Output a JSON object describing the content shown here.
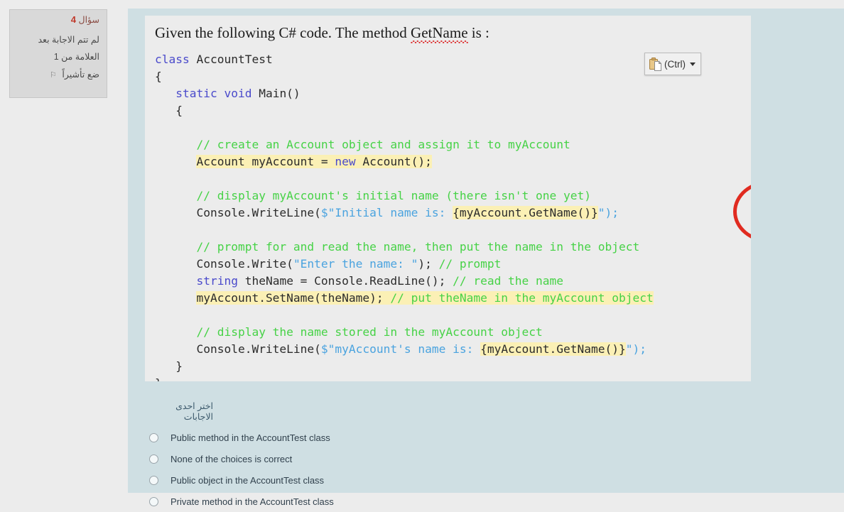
{
  "sidebar": {
    "question_word": "سؤال",
    "question_number": "4",
    "status": "لم تتم الاجابة بعد",
    "mark": "العلامة من 1",
    "flag_label": "ضع تأشيراً",
    "flag_icon": "flag-icon",
    "accent_red": "#c0392b"
  },
  "question": {
    "prompt_before": "Given the following C# code. The method ",
    "prompt_term": "GetName",
    "prompt_after": " is :"
  },
  "paste_options": {
    "label": "(Ctrl)",
    "clipboard_icon": "clipboard-icon",
    "caret_icon": "chevron-down-icon"
  },
  "code": {
    "lines": [
      [
        {
          "t": "class ",
          "c": "kw"
        },
        {
          "t": "AccountTest",
          "c": ""
        }
      ],
      [
        {
          "t": "{",
          "c": ""
        }
      ],
      [
        {
          "t": "   ",
          "c": ""
        },
        {
          "t": "static void ",
          "c": "kw"
        },
        {
          "t": "Main()",
          "c": ""
        }
      ],
      [
        {
          "t": "   {",
          "c": ""
        }
      ],
      [],
      [
        {
          "t": "      ",
          "c": ""
        },
        {
          "t": "// create an Account object and assign it to myAccount",
          "c": "cmt"
        }
      ],
      [
        {
          "t": "      ",
          "c": ""
        },
        {
          "t": "Account myAccount = ",
          "c": "hl"
        },
        {
          "t": "new",
          "c": "kw hl"
        },
        {
          "t": " Account();",
          "c": "hl"
        }
      ],
      [],
      [
        {
          "t": "      ",
          "c": ""
        },
        {
          "t": "// display myAccount's initial name (there isn't one yet)",
          "c": "cmt"
        }
      ],
      [
        {
          "t": "      ",
          "c": ""
        },
        {
          "t": "Console.WriteLine(",
          "c": ""
        },
        {
          "t": "$\"Initial name is: ",
          "c": "str"
        },
        {
          "t": "{myAccount.GetName()}",
          "c": "hl"
        },
        {
          "t": "\");",
          "c": "str"
        }
      ],
      [],
      [
        {
          "t": "      ",
          "c": ""
        },
        {
          "t": "// prompt for and read the name, then put the name in the object",
          "c": "cmt"
        }
      ],
      [
        {
          "t": "      ",
          "c": ""
        },
        {
          "t": "Console.Write(",
          "c": ""
        },
        {
          "t": "\"Enter the name: \"",
          "c": "str"
        },
        {
          "t": "); ",
          "c": ""
        },
        {
          "t": "// prompt",
          "c": "cmt"
        }
      ],
      [
        {
          "t": "      ",
          "c": ""
        },
        {
          "t": "string",
          "c": "kw"
        },
        {
          "t": " theName = Console.ReadLine(); ",
          "c": ""
        },
        {
          "t": "// read the name",
          "c": "cmt"
        }
      ],
      [
        {
          "t": "      ",
          "c": ""
        },
        {
          "t": "myAccount.SetName(theName); ",
          "c": "hl"
        },
        {
          "t": "// put theName in the myAccount object",
          "c": "cmt hl"
        }
      ],
      [],
      [
        {
          "t": "      ",
          "c": ""
        },
        {
          "t": "// display the name stored in the myAccount object",
          "c": "cmt"
        }
      ],
      [
        {
          "t": "      ",
          "c": ""
        },
        {
          "t": "Console.WriteLine(",
          "c": ""
        },
        {
          "t": "$\"myAccount's name is: ",
          "c": "str"
        },
        {
          "t": "{myAccount.GetName()}",
          "c": "hl"
        },
        {
          "t": "\");",
          "c": "str"
        }
      ],
      [
        {
          "t": "   }",
          "c": ""
        }
      ],
      [
        {
          "t": "}",
          "c": ""
        }
      ]
    ],
    "annotation": "red-circle-around-getname"
  },
  "answers": {
    "heading": "اختر احدى الاجابات",
    "options": [
      {
        "label": "Public method in the AccountTest class",
        "selected": false
      },
      {
        "label": "None of the choices is correct",
        "selected": false
      },
      {
        "label": "Public object in the AccountTest class",
        "selected": false
      },
      {
        "label": "Private method in the AccountTest class",
        "selected": false
      }
    ]
  },
  "colors": {
    "page_background": "#ececec",
    "panel_background": "#cfdfe3",
    "sidebar_background": "#d9d9d9",
    "highlight": "#fbf0b5",
    "comment": "#46d246",
    "keyword": "#4a4acb",
    "string": "#4aa3df",
    "annotation": "#e02b20"
  }
}
